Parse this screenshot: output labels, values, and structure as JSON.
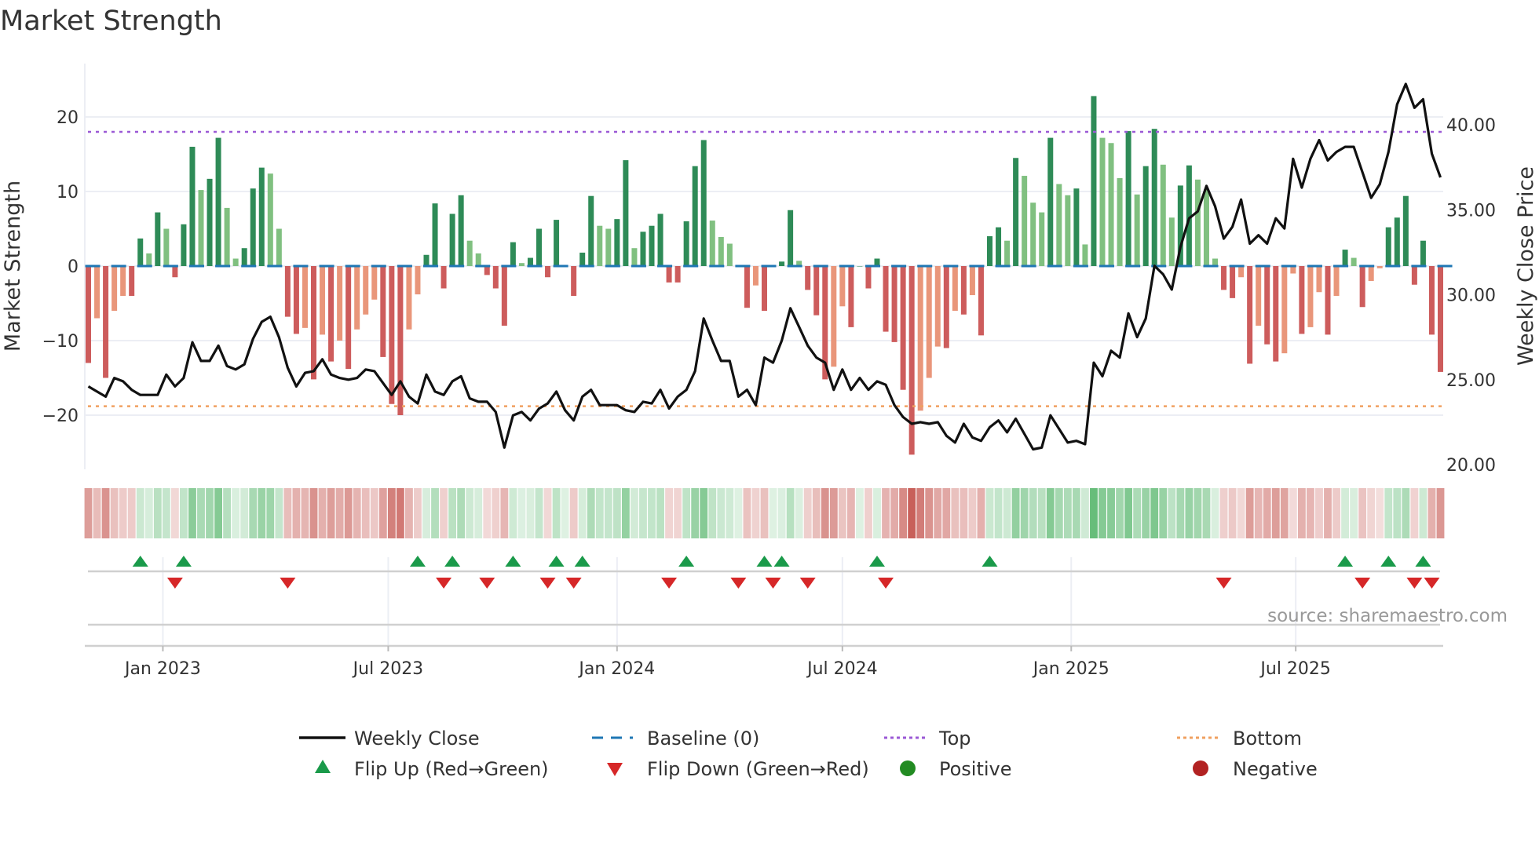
{
  "title": "Market Strength",
  "source": "source: sharemaestro.com",
  "legend": {
    "weekly_close": "Weekly Close",
    "baseline": "Baseline (0)",
    "top": "Top",
    "bottom": "Bottom",
    "flip_up": "Flip Up (Red→Green)",
    "flip_down": "Flip Down (Green→Red)",
    "positive": "Positive",
    "negative": "Negative"
  },
  "colors": {
    "dark_green": "#2e8b57",
    "light_green": "#80c080",
    "dark_red": "#cd5c5c",
    "light_red": "#e9967a",
    "baseline": "#1f77b4",
    "top": "#9b59d6",
    "bottom": "#f0a060",
    "flip_up": "#1a9a4a",
    "flip_down": "#d62728",
    "positive": "#228b22",
    "negative": "#b22222",
    "close": "#111111"
  },
  "chart_data": {
    "type": "bar",
    "title": "Market Strength",
    "ylabel": "Market Strength",
    "y2label": "Weekly Close Price",
    "ylim": [
      -27,
      28
    ],
    "y2lim": [
      19.5,
      44.2
    ],
    "yticks": [
      20,
      10,
      0,
      -10,
      -20
    ],
    "yticklabels": [
      "20",
      "10",
      "0",
      "−10",
      "−20"
    ],
    "y2ticks": [
      40,
      35,
      30,
      25,
      20
    ],
    "y2ticklabels": [
      "40.00",
      "35.00",
      "30.00",
      "25.00",
      "20.00"
    ],
    "xticks": [
      {
        "week": 8.6,
        "label": "Jan 2023"
      },
      {
        "week": 34.6,
        "label": "Jul 2023"
      },
      {
        "week": 61,
        "label": "Jan 2024"
      },
      {
        "week": 87,
        "label": "Jul 2024"
      },
      {
        "week": 113.4,
        "label": "Jan 2025"
      },
      {
        "week": 139.3,
        "label": "Jul 2025"
      }
    ],
    "top_level": 18,
    "bottom_level": -18.8,
    "baseline": 0,
    "grid": true,
    "legend_position": "bottom",
    "strength": [
      -13,
      -7,
      -15,
      -6,
      -4,
      -4,
      3.7,
      1.7,
      7.2,
      5,
      -1.5,
      5.6,
      16,
      10.2,
      11.7,
      17.2,
      7.8,
      1,
      2.4,
      10.4,
      13.2,
      12.4,
      5,
      -6.8,
      -9.1,
      -8.3,
      -15.2,
      -9.2,
      -12.8,
      -10,
      -13.8,
      -8.5,
      -6.5,
      -4.5,
      -12.2,
      -18.5,
      -20,
      -8.5,
      -3.8,
      1.5,
      8.4,
      -3,
      7,
      9.5,
      3.4,
      1.7,
      -1.2,
      -3,
      -8,
      3.2,
      0.4,
      1.1,
      5,
      -1.5,
      6.2,
      0,
      -4,
      1.8,
      9.4,
      5.4,
      5,
      6.3,
      14.2,
      2.4,
      4.6,
      5.4,
      7,
      -2.2,
      -2.2,
      6,
      13.4,
      16.9,
      6.1,
      3.9,
      3,
      0,
      -5.6,
      -2.6,
      -6,
      0.1,
      0.6,
      7.5,
      0.7,
      -3.2,
      -6.6,
      -15.2,
      -13.5,
      -5.4,
      -8.2,
      0,
      -3,
      1,
      -8.8,
      -10.2,
      -16.6,
      -25.3,
      -19.4,
      -15,
      -10.8,
      -11,
      -6,
      -6.5,
      -3.9,
      -9.3,
      4,
      5.2,
      3.4,
      14.5,
      12.1,
      8.5,
      7.2,
      17.2,
      11,
      9.5,
      10.4,
      2.9,
      22.8,
      17.2,
      16.5,
      11.8,
      18.1,
      9.6,
      13.4,
      18.4,
      13.6,
      6.5,
      10.8,
      13.5,
      11.6,
      10.3,
      1,
      -3.2,
      -4.3,
      -1.5,
      -13.1,
      -8,
      -10.5,
      -12.8,
      -11.7,
      -1,
      -9.1,
      -8.2,
      -3.5,
      -9.2,
      -4,
      2.2,
      1.1,
      -5.5,
      -2,
      -0.3,
      5.2,
      6.5,
      9.4,
      -2.5,
      3.4,
      -9.2,
      -14.2
    ],
    "close": [
      24.6,
      24.3,
      24.0,
      25.1,
      24.9,
      24.4,
      24.1,
      24.1,
      24.1,
      25.3,
      24.6,
      25.1,
      27.2,
      26.1,
      26.1,
      27.0,
      25.8,
      25.6,
      25.9,
      27.4,
      28.4,
      28.7,
      27.5,
      25.7,
      24.6,
      25.4,
      25.5,
      26.2,
      25.3,
      25.1,
      25.0,
      25.1,
      25.6,
      25.5,
      24.8,
      24.1,
      24.9,
      24.0,
      23.6,
      25.3,
      24.3,
      24.1,
      24.9,
      25.2,
      23.9,
      23.7,
      23.7,
      23.1,
      21.0,
      22.9,
      23.1,
      22.6,
      23.3,
      23.6,
      24.3,
      23.2,
      22.6,
      24.0,
      24.4,
      23.5,
      23.5,
      23.5,
      23.2,
      23.1,
      23.7,
      23.6,
      24.4,
      23.3,
      24.0,
      24.4,
      25.5,
      28.6,
      27.3,
      26.1,
      26.1,
      24.0,
      24.4,
      23.5,
      26.3,
      26.0,
      27.3,
      29.2,
      28.1,
      27.0,
      26.3,
      26.0,
      24.4,
      25.6,
      24.4,
      25.1,
      24.4,
      24.9,
      24.7,
      23.5,
      22.8,
      22.4,
      22.5,
      22.4,
      22.5,
      21.7,
      21.3,
      22.4,
      21.6,
      21.4,
      22.2,
      22.6,
      21.9,
      22.7,
      21.8,
      20.9,
      21.0,
      22.9,
      22.1,
      21.3,
      21.4,
      21.2,
      26.0,
      25.2,
      26.7,
      26.3,
      28.9,
      27.5,
      28.6,
      31.7,
      31.2,
      30.3,
      32.8,
      34.5,
      34.9,
      36.4,
      35.2,
      33.3,
      34.0,
      35.6,
      33.0,
      33.5,
      33.0,
      34.5,
      33.9,
      38.0,
      36.3,
      38.0,
      39.1,
      37.9,
      38.4,
      38.7,
      38.7,
      37.2,
      35.7,
      36.5,
      38.4,
      41.2,
      42.4,
      41.0,
      41.5,
      38.3,
      36.9
    ],
    "flip_up_weeks": [
      6,
      11,
      38,
      42,
      49,
      54,
      57,
      69,
      78,
      80,
      91,
      104,
      145,
      150,
      154
    ],
    "flip_down_weeks": [
      10,
      23,
      41,
      46,
      53,
      56,
      67,
      75,
      79,
      83,
      92,
      131,
      147,
      153,
      155
    ]
  }
}
